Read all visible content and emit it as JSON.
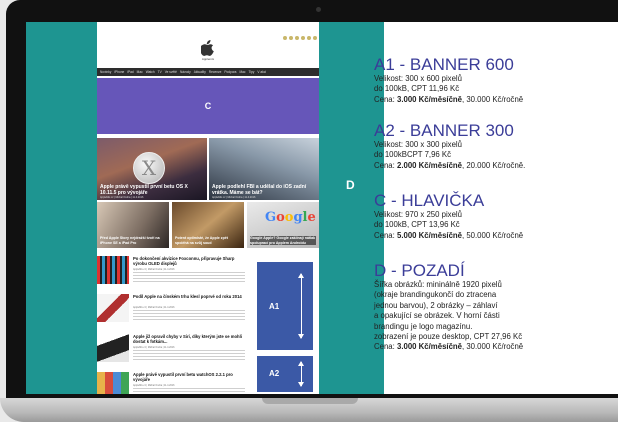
{
  "colors": {
    "teal": "#1e9591",
    "purple": "#6656b9",
    "blue": "#3b59a6",
    "title_blue": "#3b3d98"
  },
  "site": {
    "name": "Applemix",
    "nav": [
      "Novinky",
      "iPhone",
      "iPad",
      "Mac",
      "Watch",
      "TV",
      "Ve světě",
      "Návody",
      "Aktuality",
      "Recenze",
      "Podpora",
      "Mac",
      "Tipy",
      "V akci"
    ],
    "banner_c": "C",
    "hero_left": {
      "title": "Apple právě vypustil první betu OS X 10.11.5 pro vývojáře",
      "meta": "AppleMix.cz | Michal Ondra | 11.4.2016"
    },
    "hero_right": {
      "title": "Apple podlehl FBI a udělal do iOS zadní vrátka. Máme se bát?",
      "meta": "AppleMix.cz | Michal Ondra | 11.4.2016"
    },
    "row3": [
      "Před Apple Story nejdražší tvoří na iPhone SE a iPad Pro",
      "Potent optimisté, že Apple zpět spoléhá na svůj soud",
      "Google Apple? Google zaklínají nátlak spoluprací pro Applem Androidu"
    ],
    "articles": [
      {
        "title": "Po dokončení akvizice Foxconnu, připravuje Sharp výrobu OLED displejů",
        "meta": "AppleMix.cz | Michal Ondra | 11.4.2016"
      },
      {
        "title": "Podíl Apple na čínském trhu klesl poprvé od roku 2014",
        "meta": "AppleMix.cz | Michal Ondra | 11.4.2016"
      },
      {
        "title": "Apple již opravil chyby v Siri, díky kterým jste se mohli dostat k fotkám...",
        "meta": "AppleMix.cz | Michal Ondra | 11.4.2016"
      },
      {
        "title": "Apple právě vypustil první betu watchOS 2.2.1 pro vývojáře",
        "meta": "AppleMix.cz | Michal Ondra | 11.4.2016"
      }
    ],
    "banner_a1": "A1",
    "banner_a2": "A2",
    "background_label": "D"
  },
  "offers": [
    {
      "title": "A1 - BANNER 600",
      "lines": [
        "Velikost: 300 x 600 pixelů",
        "do 100kB, CPT 11,96 Kč"
      ],
      "price_label": "Cena: ",
      "price_bold": "3.000 Kč/měsíčně",
      "price_rest": ", 30.000 Kč/ročně"
    },
    {
      "title": "A2 - BANNER 300",
      "lines": [
        "Velikost: 300 x 300 pixelů",
        "do 100kBCPT 7,96 Kč"
      ],
      "price_label": "Cena: ",
      "price_bold": "2.000 Kč/měsíčně",
      "price_rest": ", 20.000 Kč/ročně."
    },
    {
      "title": "C - HLAVIČKA",
      "lines": [
        "Velikost: 970 x 250 pixelů",
        "do 100kB, CPT 13,96 Kč"
      ],
      "price_label": "Cena: ",
      "price_bold": "5.000 Kč/měsíčně",
      "price_rest": ", 50.000 Kč/ročně"
    },
    {
      "title": "D - POZADÍ",
      "lines": [
        "Šířka obrázků: mininálně 1920 pixelů",
        "(okraje brandingukončí do ztracena",
        "jednou barvou), 2 obrázky – záhlaví",
        "a opakující se obrázek. V horní části",
        "brandingu je logo magazínu.",
        "zobrazení je pouze desktop, CPT 27,96 Kč"
      ],
      "price_label": "Cena: ",
      "price_bold": "3.000 Kč/měsíčně",
      "price_rest": ", 30.000 Kč/ročně"
    }
  ]
}
